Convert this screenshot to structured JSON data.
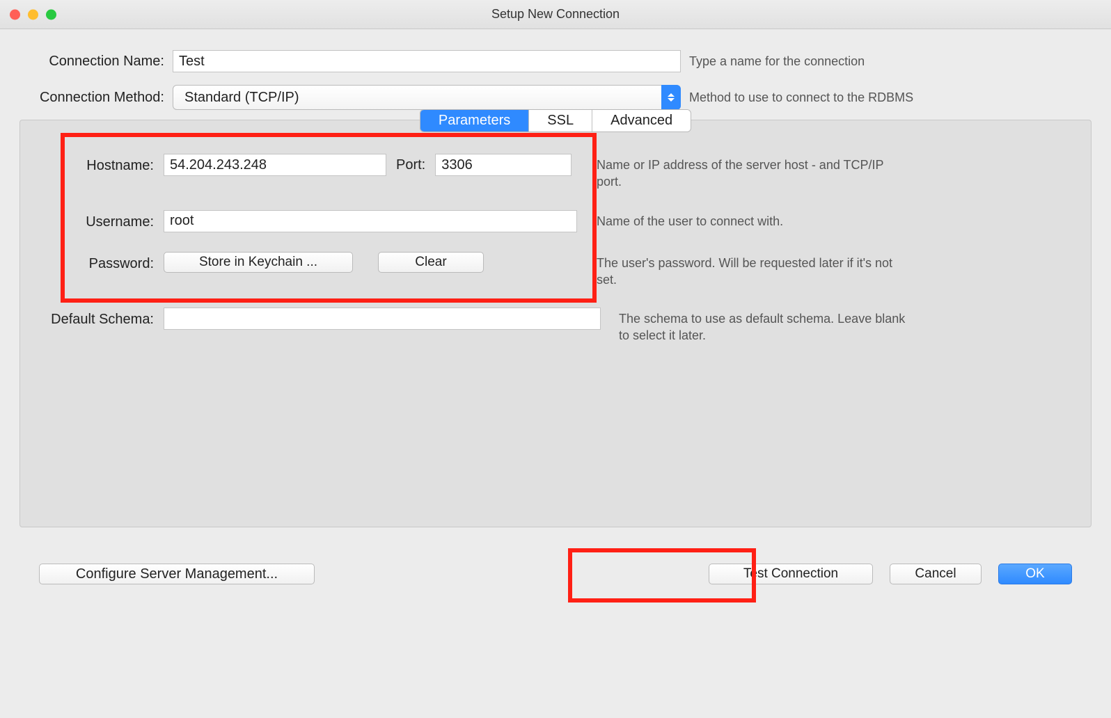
{
  "window": {
    "title": "Setup New Connection"
  },
  "form": {
    "connection_name_label": "Connection Name:",
    "connection_name_value": "Test",
    "connection_name_hint": "Type a name for the connection",
    "connection_method_label": "Connection Method:",
    "connection_method_value": "Standard (TCP/IP)",
    "connection_method_hint": "Method to use to connect to the RDBMS"
  },
  "tabs": {
    "parameters": "Parameters",
    "ssl": "SSL",
    "advanced": "Advanced"
  },
  "params": {
    "hostname_label": "Hostname:",
    "hostname_value": "54.204.243.248",
    "port_label": "Port:",
    "port_value": "3306",
    "hostname_hint": "Name or IP address of the server host - and TCP/IP port.",
    "username_label": "Username:",
    "username_value": "root",
    "username_hint": "Name of the user to connect with.",
    "password_label": "Password:",
    "store_btn": "Store in Keychain ...",
    "clear_btn": "Clear",
    "password_hint": "The user's password. Will be requested later if it's not set.",
    "schema_label": "Default Schema:",
    "schema_value": "",
    "schema_hint": "The schema to use as default schema. Leave blank to select it later."
  },
  "footer": {
    "configure_btn": "Configure Server Management...",
    "test_btn": "Test Connection",
    "cancel_btn": "Cancel",
    "ok_btn": "OK"
  }
}
